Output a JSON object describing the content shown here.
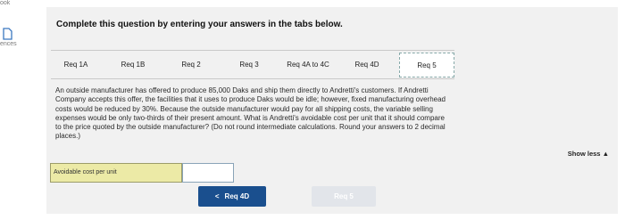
{
  "left_rail": {
    "book_label": "ook",
    "references_label": "ences"
  },
  "header": {
    "instruction": "Complete this question by entering your answers in the tabs below."
  },
  "tabs": [
    {
      "label": "Req 1A"
    },
    {
      "label": "Req 1B"
    },
    {
      "label": "Req 2"
    },
    {
      "label": "Req 3"
    },
    {
      "label": "Req 4A to 4C"
    },
    {
      "label": "Req 4D"
    },
    {
      "label": "Req 5",
      "active": true
    }
  ],
  "question": {
    "lines": [
      "An outside manufacturer has offered to produce 85,000 Daks and ship them directly to Andretti's customers. If Andretti",
      "Company accepts this offer, the facilities that it uses to produce Daks would be idle; however, fixed manufacturing overhead",
      "costs would be reduced by 30%. Because the outside manufacturer would pay for all shipping costs, the variable selling",
      "expenses would be only two-thirds of their present amount. What is Andretti's avoidable cost per unit that it should compare",
      "to the price quoted by the outside manufacturer? (Do not round intermediate calculations. Round your answers to 2 decimal",
      "places.)"
    ]
  },
  "show_less": {
    "label": "Show less",
    "icon": "triangle-up-icon"
  },
  "answer": {
    "label": "Avoidable cost per unit",
    "value": ""
  },
  "navigation": {
    "prev_label": "Req 4D",
    "prev_icon": "chevron-left-icon",
    "next_label": "Req 5"
  },
  "colors": {
    "panel": "#f1f1f1",
    "label_fill": "#eceaa6",
    "prev_button": "#1a4f8e",
    "next_button_disabled": "#e2e5ea"
  }
}
